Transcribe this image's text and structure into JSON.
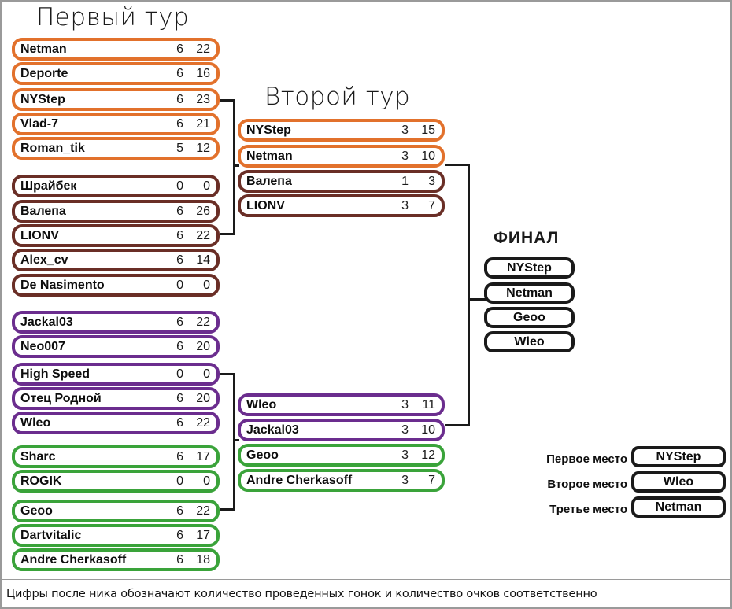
{
  "titles": {
    "round1": "Первый тур",
    "round2": "Второй тур",
    "final": "ФИНАЛ"
  },
  "colors": {
    "group_orange": "#e2712c",
    "group_brown": "#6a2e26",
    "group_purple": "#6b2d8e",
    "group_green": "#3aa33a",
    "final_black": "#1a1a1a"
  },
  "round1": {
    "groups": [
      {
        "color": "#e2712c",
        "rows": [
          {
            "nick": "Netman",
            "races": "6",
            "points": "22"
          },
          {
            "nick": "Deporte",
            "races": "6",
            "points": "16"
          },
          {
            "nick": "NYStep",
            "races": "6",
            "points": "23"
          },
          {
            "nick": "Vlad-7",
            "races": "6",
            "points": "21"
          },
          {
            "nick": "Roman_tik",
            "races": "5",
            "points": "12"
          }
        ]
      },
      {
        "color": "#6a2e26",
        "rows": [
          {
            "nick": "Шрайбек",
            "races": "0",
            "points": "0"
          },
          {
            "nick": "Валепа",
            "races": "6",
            "points": "26"
          },
          {
            "nick": "LIONV",
            "races": "6",
            "points": "22"
          },
          {
            "nick": "Alex_cv",
            "races": "6",
            "points": "14"
          },
          {
            "nick": "De Nasimento",
            "races": "0",
            "points": "0"
          }
        ]
      },
      {
        "color": "#6b2d8e",
        "rows": [
          {
            "nick": "Jackal03",
            "races": "6",
            "points": "22"
          },
          {
            "nick": "Neo007",
            "races": "6",
            "points": "20"
          },
          {
            "nick": "High Speed",
            "races": "0",
            "points": "0"
          },
          {
            "nick": "Отец Родной",
            "races": "6",
            "points": "20"
          },
          {
            "nick": "Wleo",
            "races": "6",
            "points": "22"
          }
        ]
      },
      {
        "color": "#3aa33a",
        "rows": [
          {
            "nick": "Sharc",
            "races": "6",
            "points": "17"
          },
          {
            "nick": "ROGIK",
            "races": "0",
            "points": "0"
          },
          {
            "nick": "Geoo",
            "races": "6",
            "points": "22"
          },
          {
            "nick": "Dartvitalic",
            "races": "6",
            "points": "17"
          },
          {
            "nick": "Andre Cherkasoff",
            "races": "6",
            "points": "18"
          }
        ]
      }
    ]
  },
  "round2": {
    "groups": [
      {
        "color": "#e2712c",
        "rows": [
          {
            "nick": "NYStep",
            "races": "3",
            "points": "15"
          },
          {
            "nick": "Netman",
            "races": "3",
            "points": "10"
          }
        ]
      },
      {
        "color": "#6a2e26",
        "rows": [
          {
            "nick": "Валепа",
            "races": "1",
            "points": "3"
          },
          {
            "nick": "LIONV",
            "races": "3",
            "points": "7"
          }
        ]
      },
      {
        "color": "#6b2d8e",
        "rows": [
          {
            "nick": "Wleo",
            "races": "3",
            "points": "11"
          },
          {
            "nick": "Jackal03",
            "races": "3",
            "points": "10"
          }
        ]
      },
      {
        "color": "#3aa33a",
        "rows": [
          {
            "nick": "Geoo",
            "races": "3",
            "points": "12"
          },
          {
            "nick": "Andre Cherkasoff",
            "races": "3",
            "points": "7"
          }
        ]
      }
    ]
  },
  "final": {
    "rows": [
      {
        "nick": "NYStep"
      },
      {
        "nick": "Netman"
      },
      {
        "nick": "Geoo"
      },
      {
        "nick": "Wleo"
      }
    ]
  },
  "placements": [
    {
      "label": "Первое место",
      "nick": "NYStep"
    },
    {
      "label": "Второе место",
      "nick": "Wleo"
    },
    {
      "label": "Третье место",
      "nick": "Netman"
    }
  ],
  "footer": {
    "note": "Цифры после ника обозначают количество проведенных гонок и количество очков соответственно"
  }
}
